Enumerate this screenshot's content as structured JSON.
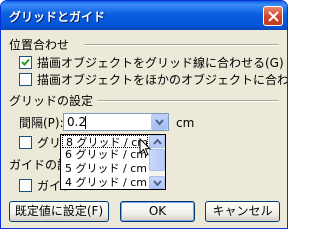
{
  "window": {
    "title": "グリッドとガイド"
  },
  "groups": {
    "alignment": "位置合わせ",
    "grid_settings": "グリッドの設定",
    "guide_settings": "ガイドの設"
  },
  "options": {
    "snap_grid": {
      "label": "描画オブジェクトをグリッド線に合わせる(G)",
      "checked": true
    },
    "snap_objects": {
      "label": "描画オブジェクトをほかのオブジェクトに合わせる(S)",
      "checked": false
    },
    "show_grid": {
      "label": "グリッド",
      "checked": false
    },
    "show_guides": {
      "label": "ガイド",
      "checked": false
    }
  },
  "spacing": {
    "label": "間隔(P):",
    "value": "0.2",
    "unit": "cm",
    "options": [
      "8 グリッド / cm",
      "6 グリッド / cm",
      "5 グリッド / cm",
      "4 グリッド / cm"
    ],
    "selected": "8 グリッド / cm"
  },
  "buttons": {
    "default": "既定値に設定(F)",
    "ok": "OK",
    "cancel": "キャンセル"
  },
  "icons": {
    "close": "close-icon",
    "dropdown": "chevron-down-icon",
    "scroll_up": "scroll-up-icon",
    "scroll_down": "scroll-down-icon",
    "check": "checkmark-icon",
    "cursor": "mouse-pointer-icon"
  }
}
